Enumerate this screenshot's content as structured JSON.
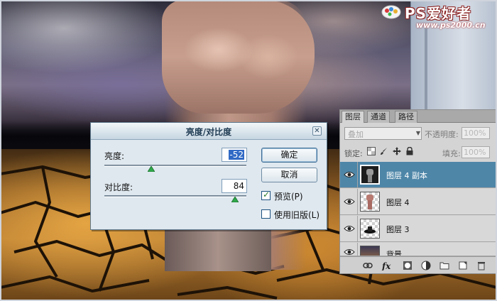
{
  "watermark": {
    "brand": "PS爱好者",
    "url": "www.ps2000.cn"
  },
  "dialog": {
    "title": "亮度/对比度",
    "brightness_label": "亮度:",
    "brightness_value": "-52",
    "brightness_level": 0.33,
    "contrast_label": "对比度:",
    "contrast_value": "84",
    "contrast_level": 0.92,
    "ok_label": "确定",
    "cancel_label": "取消",
    "preview_label": "预览(P)",
    "preview_checked": true,
    "legacy_label": "使用旧版(L)",
    "legacy_checked": false
  },
  "layers_panel": {
    "tabs": [
      {
        "label": "图层",
        "active": true
      },
      {
        "label": "通道",
        "active": false
      },
      {
        "label": "路径",
        "active": false
      }
    ],
    "blend_mode": "叠加",
    "opacity_label": "不透明度:",
    "opacity_value": "100%",
    "lock_label": "锁定:",
    "fill_label": "填充:",
    "fill_value": "100%",
    "layers": [
      {
        "name": "图层 4 副本",
        "selected": true,
        "visible": true
      },
      {
        "name": "图层 4",
        "selected": false,
        "visible": true
      },
      {
        "name": "图层 3",
        "selected": false,
        "visible": true
      },
      {
        "name": "背景",
        "selected": false,
        "visible": true
      }
    ],
    "footer_icons": [
      "link-icon",
      "fx-icon",
      "mask-icon",
      "adjustment-icon",
      "group-folder-icon",
      "new-layer-icon",
      "trash-icon"
    ]
  },
  "colors": {
    "selected_layer": "#4e86a8",
    "dialog_bg": "#dfe8ef",
    "brand_red": "#b02020"
  }
}
